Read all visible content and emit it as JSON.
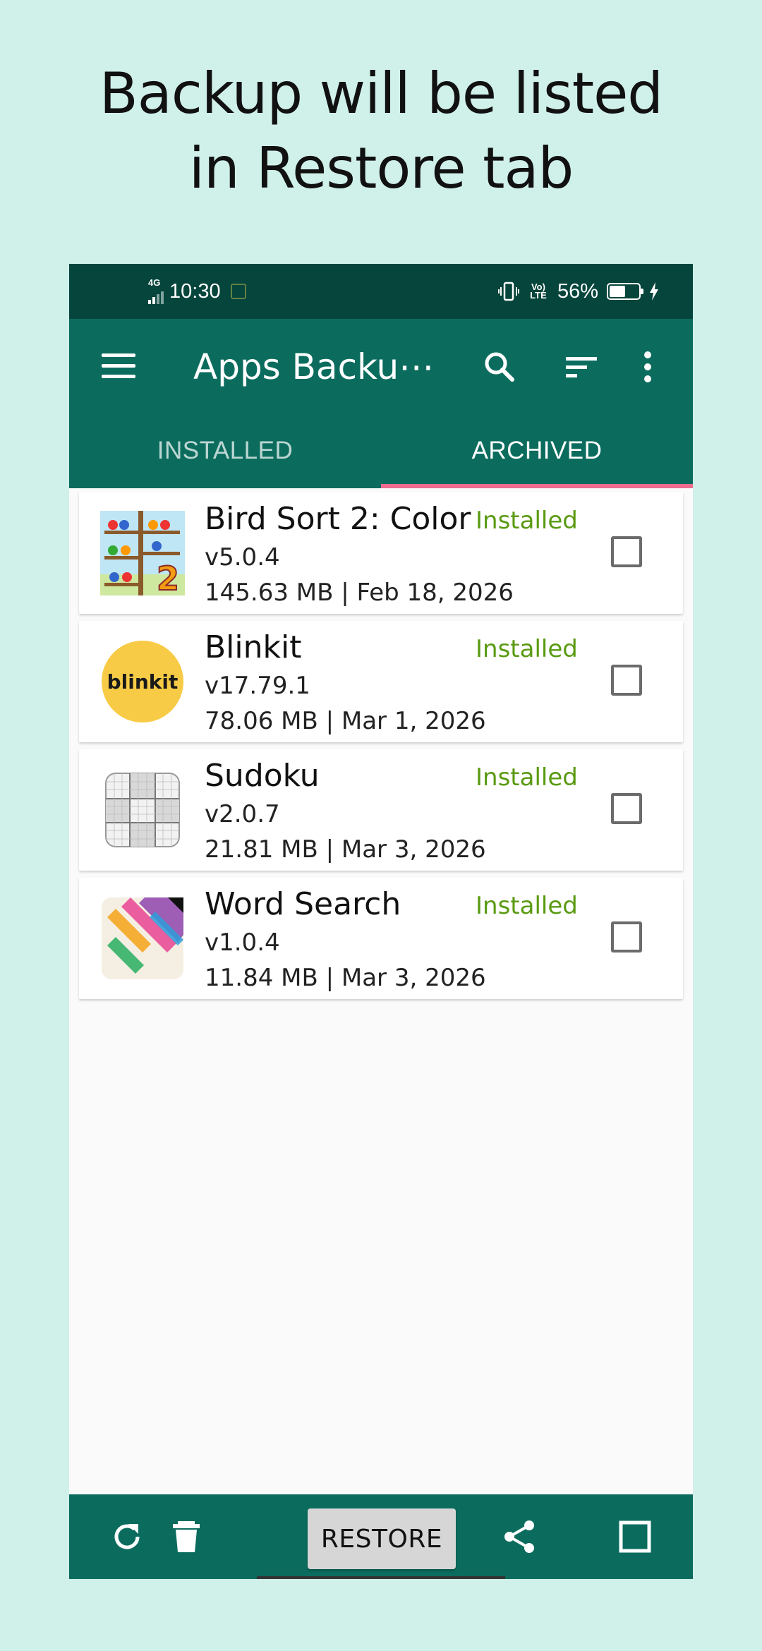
{
  "headline": {
    "line1": "Backup will be listed",
    "line2": "in Restore tab"
  },
  "status_bar": {
    "network": "4G",
    "time": "10:30",
    "volte": "Vo) LTE",
    "battery_percent": "56%",
    "battery_level": 0.56
  },
  "toolbar": {
    "title": "Apps Backu⋯",
    "icons": [
      "menu-icon",
      "search-icon",
      "sort-icon",
      "more-vert-icon"
    ]
  },
  "tabs": [
    {
      "label": "INSTALLED",
      "active": false
    },
    {
      "label": "ARCHIVED",
      "active": true
    }
  ],
  "apps": [
    {
      "name": "Bird Sort 2: Color",
      "version": "v5.0.4",
      "meta": "145.63 MB | Feb 18, 2026",
      "status": "Installed",
      "checked": false
    },
    {
      "name": "Blinkit",
      "version": "v17.79.1",
      "meta": "78.06 MB | Mar 1, 2026",
      "status": "Installed",
      "checked": false,
      "icon_text": "blinkit"
    },
    {
      "name": "Sudoku",
      "version": "v2.0.7",
      "meta": "21.81 MB | Mar 3, 2026",
      "status": "Installed",
      "checked": false
    },
    {
      "name": "Word Search",
      "version": "v1.0.4",
      "meta": "11.84 MB | Mar 3, 2026",
      "status": "Installed",
      "checked": false
    }
  ],
  "bottom_bar": {
    "restore_label": "RESTORE",
    "icons": [
      "refresh-icon",
      "delete-icon",
      "share-icon",
      "select-all-checkbox-icon"
    ]
  },
  "colors": {
    "page_background": "#d0f0ea",
    "status_bar": "#05453b",
    "app_bar": "#0b6c5e",
    "tab_indicator": "#ef6b8f",
    "installed_text": "#5a9a12"
  }
}
